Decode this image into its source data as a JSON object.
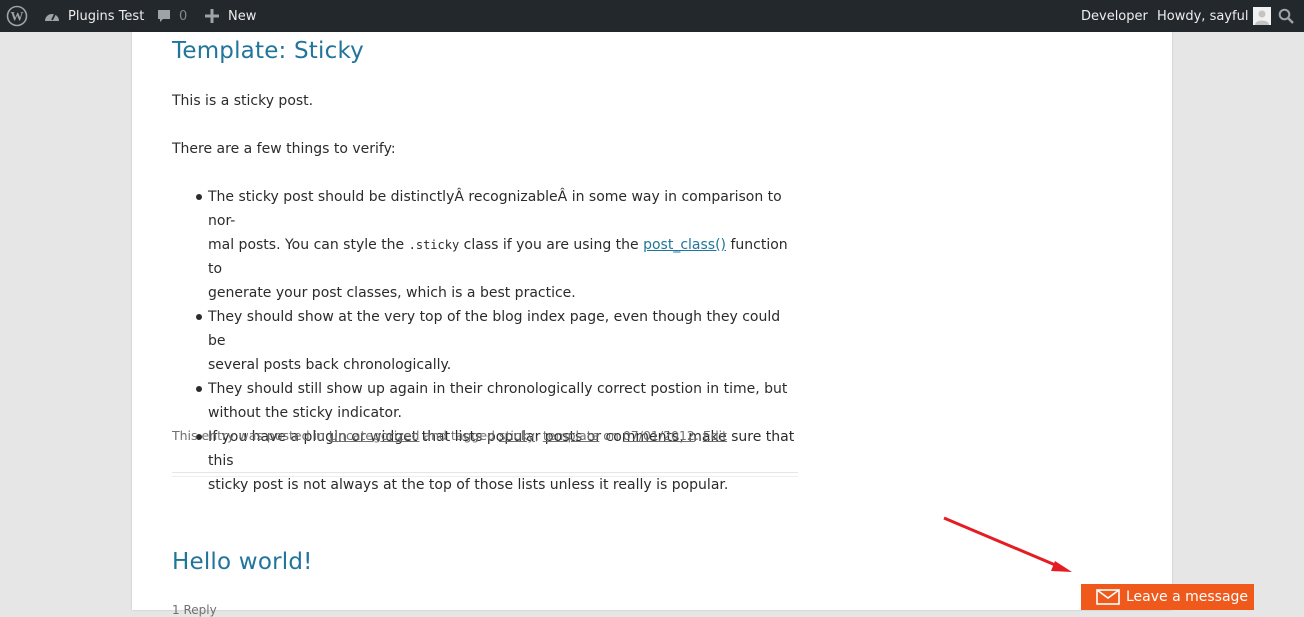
{
  "adminbar": {
    "site_name": "Plugins Test",
    "comments_count": "0",
    "new_label": "New",
    "developer_label": "Developer",
    "howdy_label": "Howdy, sayful"
  },
  "posts": [
    {
      "title": "Template: Sticky",
      "intro": "This is a sticky post.",
      "verify_intro": "There are a few things to verify:",
      "items": [
        {
          "line1": "The sticky post should be distinctlyÂ recognizableÂ in some way in comparison to nor-",
          "line2_a": "mal posts. You can style the ",
          "line2_code": ".sticky",
          "line2_b": " class if you are using the ",
          "line2_link": "post_class()",
          "line2_c": " function to",
          "line3": "generate your post classes, which is a best practice."
        },
        {
          "line1": "They should show at the very top of the blog index page, even though they could be",
          "line2": "several posts back chronologically."
        },
        {
          "line1": "They should still show up again in their chronologically correct postion in time, but",
          "line2": "without the sticky indicator."
        },
        {
          "line1": "If you have a plugin or widget that lists popular posts or comments, make sure that this",
          "line2": "sticky post is not always at the top of those lists unless it really is popular."
        }
      ],
      "meta": {
        "prefix": "This entry was posted in ",
        "category": "Uncategorized",
        "tagged": " and tagged ",
        "tag1": "sticky",
        "comma": ", ",
        "tag2": "template",
        "on": " on ",
        "date": "07/01/2012",
        "dot": ". ",
        "edit": "Edit"
      }
    },
    {
      "title": "Hello world!",
      "reply": "1 Reply"
    }
  ],
  "widget": {
    "leave_message_label": "Leave a message",
    "accent": "#ef5a1c"
  },
  "colors": {
    "adminbar_bg": "#23282d",
    "link": "#21759b",
    "page_bg": "#e6e6e6",
    "arrow": "#e51c23"
  },
  "icons": [
    "wordpress-logo-icon",
    "dashboard-icon",
    "comment-icon",
    "plus-icon",
    "avatar",
    "search-icon",
    "mail-icon"
  ]
}
